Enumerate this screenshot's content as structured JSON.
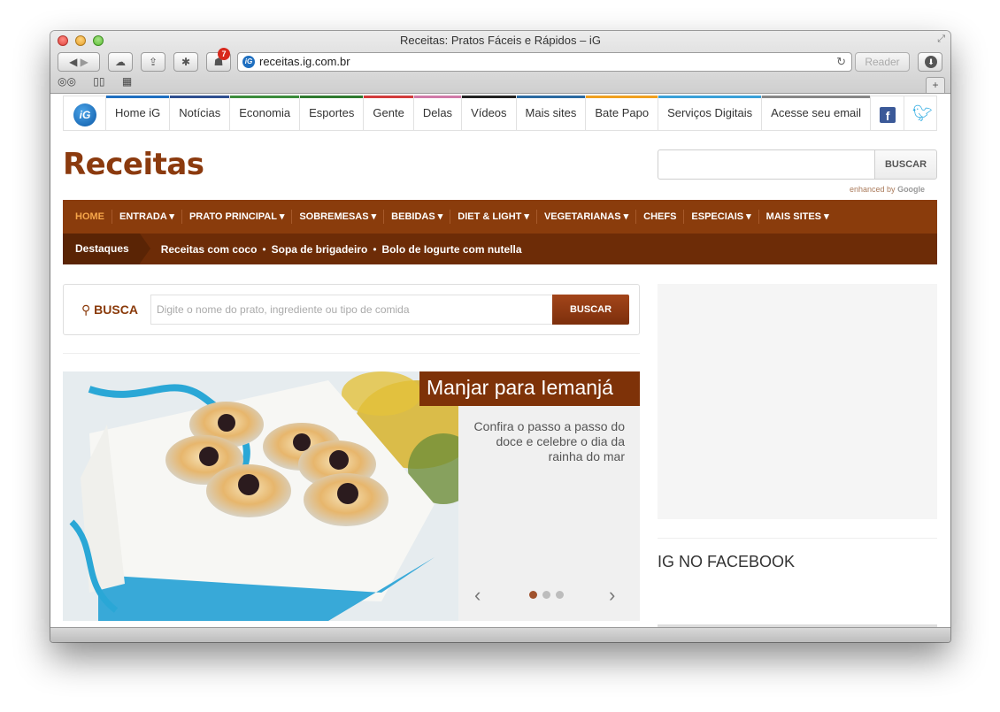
{
  "window": {
    "title": "Receitas: Pratos Fáceis e Rápidos – iG"
  },
  "toolbar": {
    "url": "receitas.ig.com.br",
    "reader_label": "Reader",
    "notification_count": "7",
    "new_tab_label": "+"
  },
  "topnav": {
    "items": [
      {
        "label": "Home iG",
        "color": "#1f6fc0"
      },
      {
        "label": "Notícias",
        "color": "#2f4f8f"
      },
      {
        "label": "Economia",
        "color": "#3c8c3c"
      },
      {
        "label": "Esportes",
        "color": "#2f7a2f"
      },
      {
        "label": "Gente",
        "color": "#d23c3c"
      },
      {
        "label": "Delas",
        "color": "#d07aa8"
      },
      {
        "label": "Vídeos",
        "color": "#222222"
      },
      {
        "label": "Mais sites",
        "color": "#2b6aa0"
      },
      {
        "label": "Bate Papo",
        "color": "#f0a020"
      },
      {
        "label": "Serviços Digitais",
        "color": "#3aa0d8"
      },
      {
        "label": "Acesse seu email",
        "color": "#888888"
      }
    ]
  },
  "header": {
    "site_title": "Receitas",
    "search_button": "BUSCAR",
    "enhanced_by": "enhanced by",
    "google": "Google"
  },
  "mainnav": {
    "items": [
      {
        "label": "HOME",
        "active": true
      },
      {
        "label": "ENTRADA ▾"
      },
      {
        "label": "PRATO PRINCIPAL ▾"
      },
      {
        "label": "SOBREMESAS ▾"
      },
      {
        "label": "BEBIDAS ▾"
      },
      {
        "label": "DIET & LIGHT ▾"
      },
      {
        "label": "VEGETARIANAS ▾"
      },
      {
        "label": "CHEFS"
      },
      {
        "label": "ESPECIAIS ▾"
      },
      {
        "label": "MAIS SITES ▾"
      }
    ]
  },
  "highlights": {
    "label": "Destaques",
    "links": [
      "Receitas com coco",
      "Sopa de brigadeiro",
      "Bolo de Iogurte com nutella"
    ]
  },
  "busca": {
    "label": "BUSCA",
    "placeholder": "Digite o nome do prato, ingrediente ou tipo de comida",
    "button": "BUSCAR"
  },
  "slider": {
    "title": "Manjar para Iemanjá",
    "description": "Confira o passo a passo do doce e celebre o dia da rainha do mar",
    "dot_count": 3,
    "active_dot": 1
  },
  "sidebar": {
    "facebook_heading": "IG NO FACEBOOK"
  }
}
